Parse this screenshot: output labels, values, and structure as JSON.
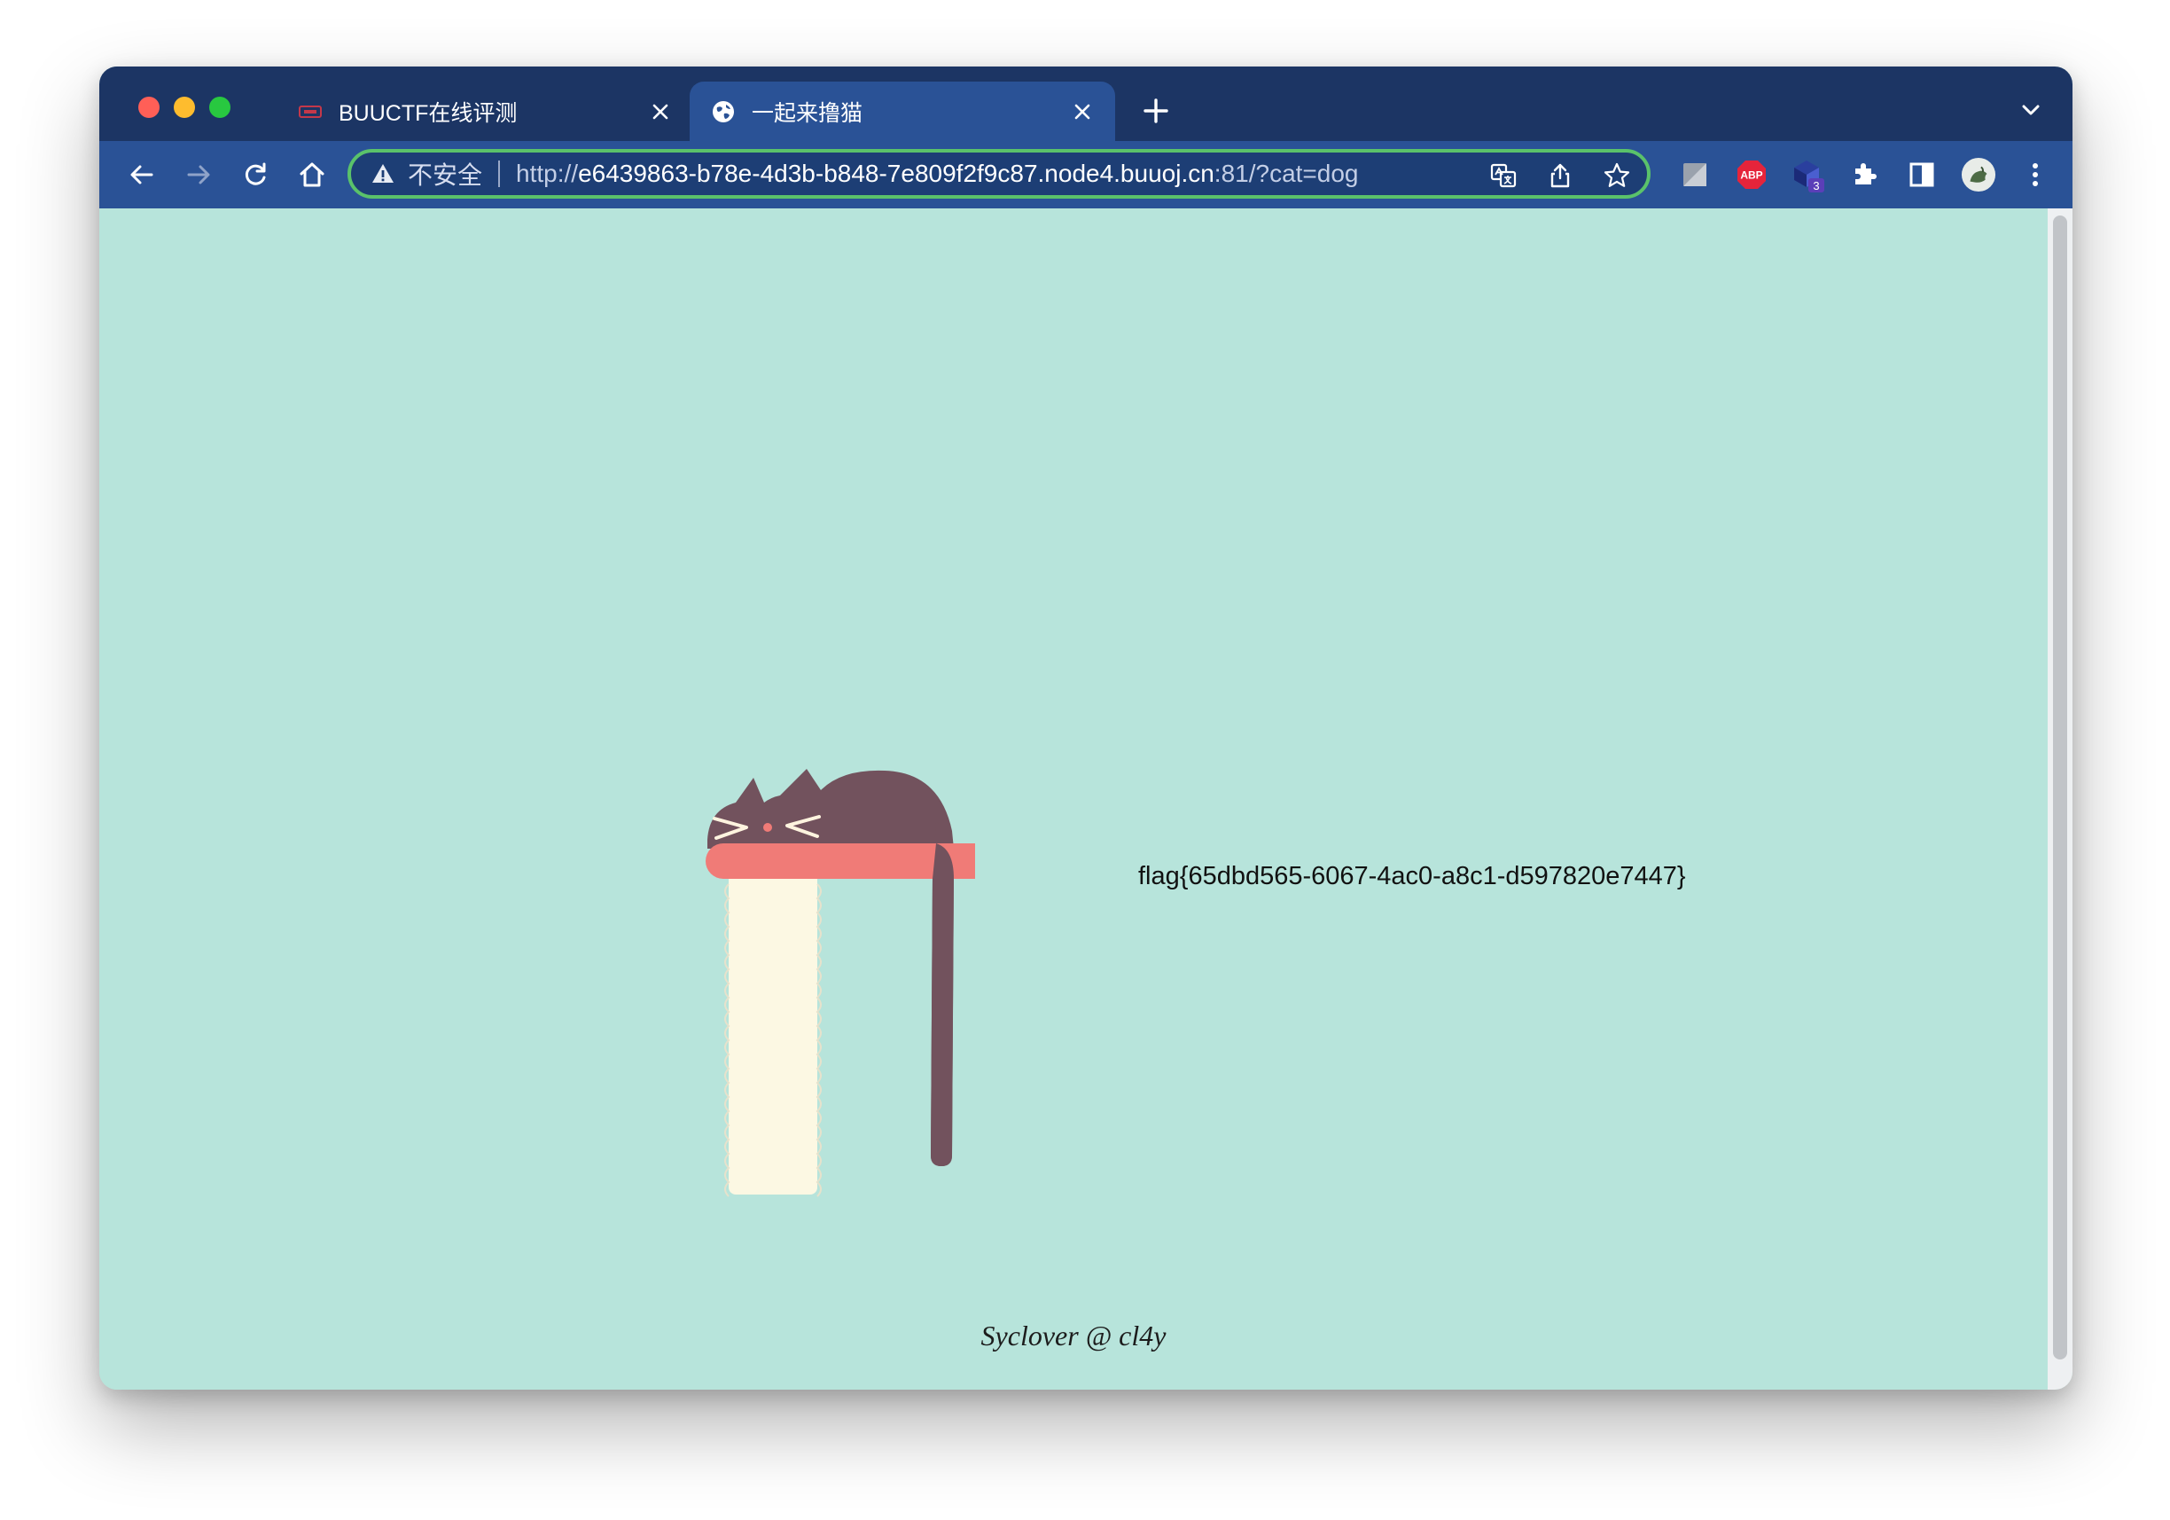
{
  "browser": {
    "tabs": [
      {
        "title": "BUUCTF在线评测",
        "favicon": "buuctf-logo-icon",
        "active": false
      },
      {
        "title": "一起来撸猫",
        "favicon": "globe-icon",
        "active": true
      }
    ],
    "omnibox": {
      "security_label": "不安全",
      "url_scheme": "http://",
      "url_host": "e6439863-b78e-4d3b-b848-7e809f2f9c87.node4.buuoj.cn",
      "url_rest": ":81/?cat=dog"
    },
    "extensions": {
      "abp_label": "ABP",
      "badge_count": "3"
    },
    "colors": {
      "tabstrip": "#1c3564",
      "toolbar": "#2a5296",
      "omnibox_border": "#5ac26a"
    }
  },
  "page": {
    "flag_text": "flag{65dbd565-6067-4ac0-a8c1-d597820e7447}",
    "footer_text": "Syclover @ cl4y",
    "background": "#b7e4db"
  }
}
